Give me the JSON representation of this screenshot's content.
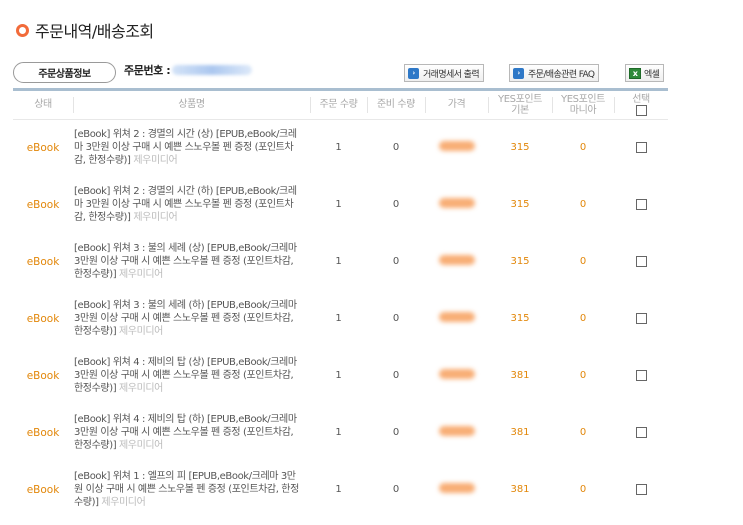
{
  "page": {
    "title": "주문내역/배송조회"
  },
  "order": {
    "tab_label": "주문상품정보",
    "order_no_label": "주문번호 :"
  },
  "toolbar": {
    "receipt_label": "거래명세서 출력",
    "faq_label": "주문/배송관련 FAQ",
    "excel_label": "엑셀"
  },
  "table": {
    "headers": {
      "type": "상태",
      "product": "상품명",
      "order_qty": "주문 수량",
      "ready_qty": "준비 수량",
      "price": "가격",
      "yes_basic_1": "YES포인트",
      "yes_basic_2": "기본",
      "yes_mania_1": "YES포인트",
      "yes_mania_2": "마니아",
      "select_label": "선택"
    },
    "rows": [
      {
        "type": "eBook",
        "title": "[eBook] 위쳐 2 : 경멸의 시간 (상) [EPUB,eBook/크레마 3만원 이상 구매 시 예쁜 스노우볼 펜 증정 (포인트차감, 한정수량)]",
        "publisher": "제우미디어",
        "order_qty": "1",
        "ready_qty": "0",
        "yes_basic": "315",
        "yes_mania": "0"
      },
      {
        "type": "eBook",
        "title": "[eBook] 위쳐 2 : 경멸의 시간 (하) [EPUB,eBook/크레마 3만원 이상 구매 시 예쁜 스노우볼 펜 증정 (포인트차감, 한정수량)]",
        "publisher": "제우미디어",
        "order_qty": "1",
        "ready_qty": "0",
        "yes_basic": "315",
        "yes_mania": "0"
      },
      {
        "type": "eBook",
        "title": "[eBook] 위쳐 3 : 불의 세례 (상) [EPUB,eBook/크레마 3만원 이상 구매 시 예쁜 스노우볼 펜 증정 (포인트차감, 한정수량)]",
        "publisher": "제우미디어",
        "order_qty": "1",
        "ready_qty": "0",
        "yes_basic": "315",
        "yes_mania": "0"
      },
      {
        "type": "eBook",
        "title": "[eBook] 위쳐 3 : 불의 세례 (하) [EPUB,eBook/크레마 3만원 이상 구매 시 예쁜 스노우볼 펜 증정 (포인트차감, 한정수량)]",
        "publisher": "제우미디어",
        "order_qty": "1",
        "ready_qty": "0",
        "yes_basic": "315",
        "yes_mania": "0"
      },
      {
        "type": "eBook",
        "title": "[eBook] 위쳐 4 : 제비의 탑 (상) [EPUB,eBook/크레마 3만원 이상 구매 시 예쁜 스노우볼 펜 증정 (포인트차감, 한정수량)]",
        "publisher": "제우미디어",
        "order_qty": "1",
        "ready_qty": "0",
        "yes_basic": "381",
        "yes_mania": "0"
      },
      {
        "type": "eBook",
        "title": "[eBook] 위쳐 4 : 제비의 탑 (하) [EPUB,eBook/크레마 3만원 이상 구매 시 예쁜 스노우볼 펜 증정 (포인트차감, 한정수량)]",
        "publisher": "제우미디어",
        "order_qty": "1",
        "ready_qty": "0",
        "yes_basic": "381",
        "yes_mania": "0"
      },
      {
        "type": "eBook",
        "title": "[eBook] 위쳐 1 : 엘프의 피 [EPUB,eBook/크레마 3만원 이상 구매 시 예쁜 스노우볼 펜 증정 (포인트차감, 한정수량)]",
        "publisher": "제우미디어",
        "order_qty": "1",
        "ready_qty": "0",
        "yes_basic": "381",
        "yes_mania": "0"
      }
    ]
  },
  "icons": {
    "title": "circle-bullet-icon",
    "info": "info-icon",
    "excel": "excel-icon"
  },
  "colors": {
    "accent": "#f26b3a",
    "status": "#e2870a",
    "header_rule": "#a9bed0"
  }
}
